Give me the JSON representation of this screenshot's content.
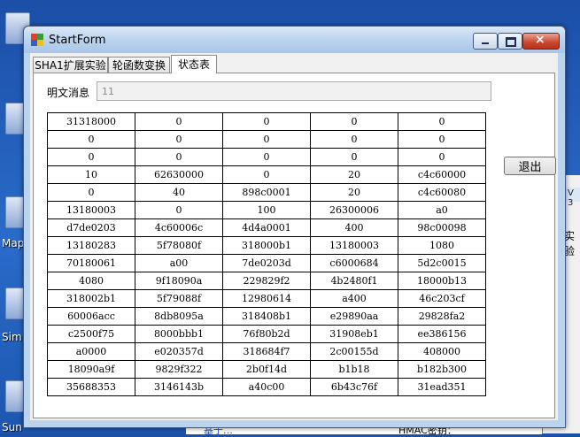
{
  "window": {
    "title": "StartForm",
    "controls": {
      "minimize": "minimize",
      "maximize": "maximize",
      "close": "×"
    }
  },
  "tabs": [
    {
      "label": "SHA1扩展实验"
    },
    {
      "label": "轮函数变换"
    },
    {
      "label": "状态表"
    }
  ],
  "active_tab": 2,
  "plaintext": {
    "label": "明文消息",
    "value": "11"
  },
  "exit_button": "退出",
  "state_table": [
    [
      "31318000",
      "0",
      "0",
      "0",
      "0"
    ],
    [
      "0",
      "0",
      "0",
      "0",
      "0"
    ],
    [
      "0",
      "0",
      "0",
      "0",
      "0"
    ],
    [
      "10",
      "62630000",
      "0",
      "20",
      "c4c60000"
    ],
    [
      "0",
      "40",
      "898c0001",
      "20",
      "c4c60080"
    ],
    [
      "13180003",
      "0",
      "100",
      "26300006",
      "a0"
    ],
    [
      "d7de0203",
      "4c60006c",
      "4d4a0001",
      "400",
      "98c00098"
    ],
    [
      "13180283",
      "5f78080f",
      "318000b1",
      "13180003",
      "1080"
    ],
    [
      "70180061",
      "a00",
      "7de0203d",
      "c6000684",
      "5d2c0015"
    ],
    [
      "4080",
      "9f18090a",
      "229829f2",
      "4b2480f1",
      "18000b13"
    ],
    [
      "318002b1",
      "5f79088f",
      "12980614",
      "a400",
      "46c203cf"
    ],
    [
      "60006acc",
      "8db8095a",
      "318408b1",
      "e29890aa",
      "29828fa2"
    ],
    [
      "c2500f75",
      "8000bbb1",
      "76f80b2d",
      "31908eb1",
      "ee386156"
    ],
    [
      "a0000",
      "e020357d",
      "318684f7",
      "2c00155d",
      "408000"
    ],
    [
      "18090a9f",
      "9829f322",
      "2b0f14d",
      "b1b18",
      "b182b300"
    ],
    [
      "35688353",
      "3146143b",
      "a40c00",
      "6b43c76f",
      "31ead351"
    ]
  ],
  "background": {
    "desktop_labels": [
      "Map",
      "Sim",
      "Sun"
    ],
    "side_window_text": [
      "V 3",
      "实验"
    ],
    "bottom_text": [
      "基于…",
      "HMAC密钥："
    ]
  }
}
